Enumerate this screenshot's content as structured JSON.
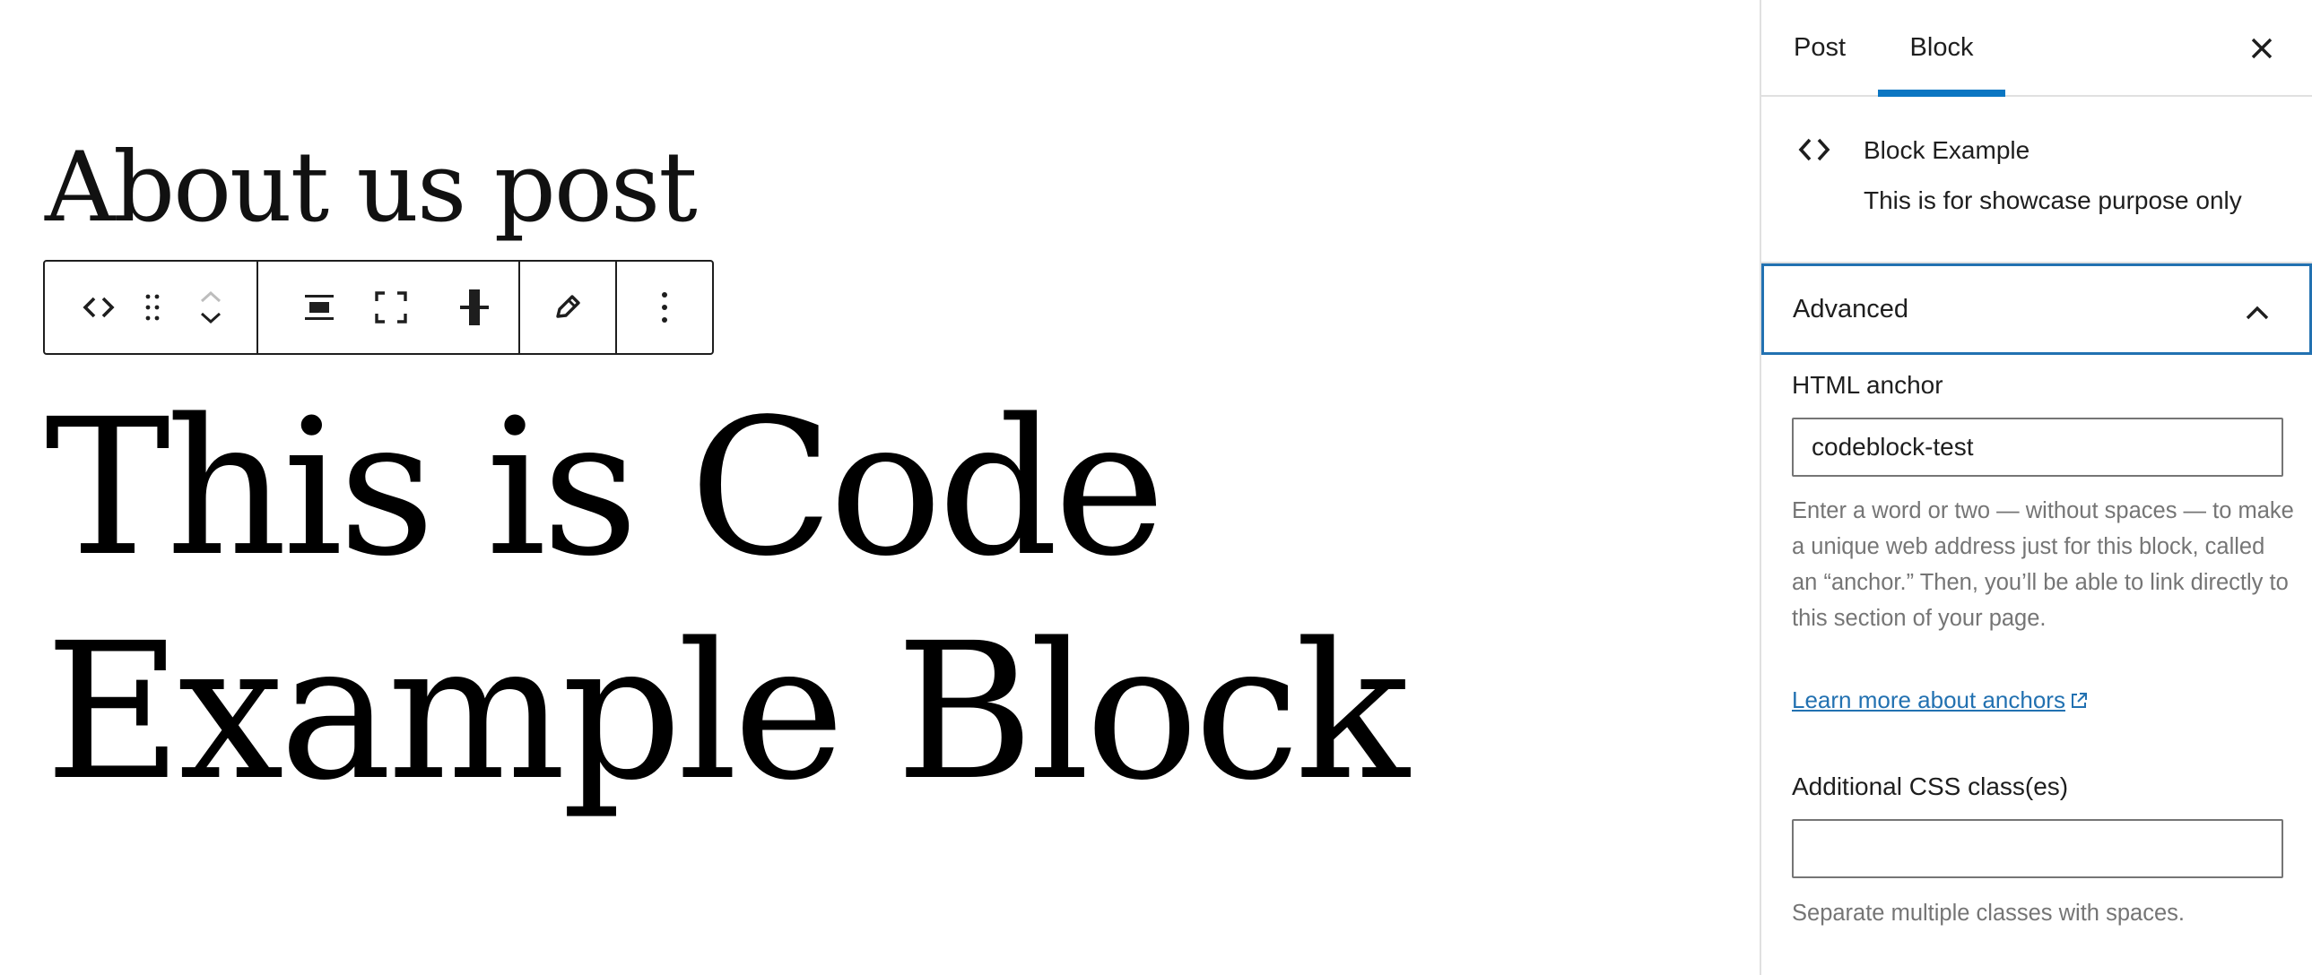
{
  "editor": {
    "post_title": "About us post",
    "block_text_line1": "This is Code",
    "block_text_line2": "Example Block",
    "toolbar": {
      "block_type_icon": "code-brackets-icon",
      "drag_icon": "drag-handle-icon",
      "move_up_icon": "chevron-up-icon",
      "move_down_icon": "chevron-down-icon",
      "align_icon": "align-center-icon",
      "full_width_icon": "full-width-icon",
      "vertical_align_icon": "vertical-align-icon",
      "edit_icon": "pencil-icon",
      "options_icon": "more-vertical-icon"
    }
  },
  "sidebar": {
    "tabs": [
      {
        "label": "Post",
        "active": false
      },
      {
        "label": "Block",
        "active": true
      }
    ],
    "close_icon": "close-icon",
    "block_card": {
      "icon": "code-brackets-icon",
      "title": "Block Example",
      "description": "This is for showcase purpose only"
    },
    "advanced": {
      "title": "Advanced",
      "expanded": true,
      "chevron_icon": "chevron-up-icon",
      "html_anchor_label": "HTML anchor",
      "html_anchor_value": "codeblock-test",
      "html_anchor_help": "Enter a word or two — without spaces — to make a unique web address just for this block, called an “anchor.” Then, you’ll be able to link directly to this section of your page.",
      "learn_more_link": "Learn more about anchors",
      "external_icon": "external-link-icon",
      "css_label": "Additional CSS class(es)",
      "css_value": "",
      "css_help": "Separate multiple classes with spaces."
    }
  },
  "colors": {
    "accent": "#0b76c2",
    "focus_border": "#2271b1",
    "link": "#2271b1",
    "help_text": "#757575",
    "divider": "#e0e0e0"
  }
}
